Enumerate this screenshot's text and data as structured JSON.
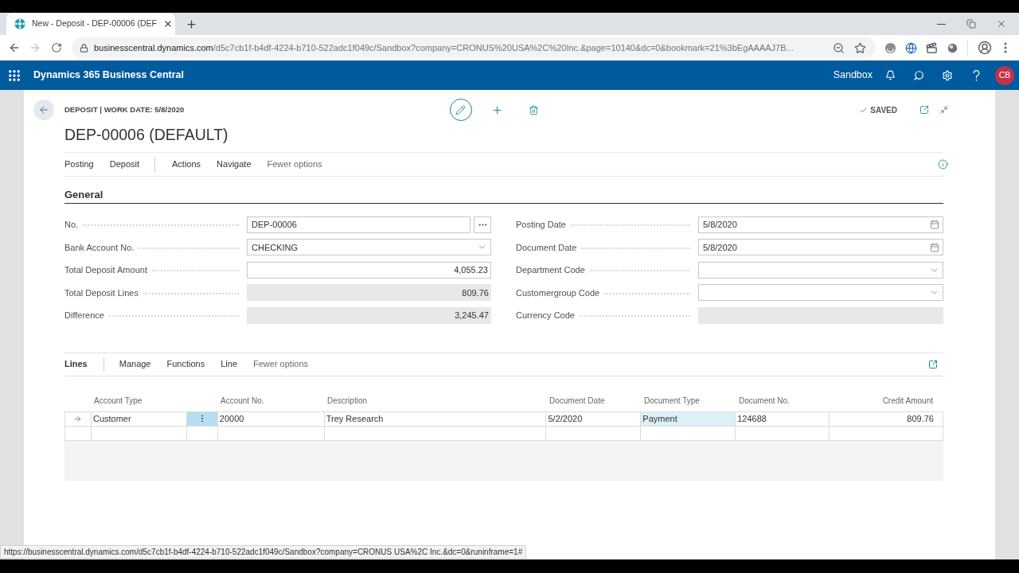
{
  "browser": {
    "tab_title": "New - Deposit - DEP-00006 (DEF",
    "forward_disabled": true,
    "url_host": "businesscentral.dynamics.com",
    "url_path": "/d5c7cb1f-b4df-4224-b710-522adc1f049c/Sandbox?company=CRONUS%20USA%2C%20Inc.&page=10140&dc=0&bookmark=21%3bEgAAAAJ7B...",
    "status_url": "https://businesscentral.dynamics.com/d5c7cb1f-b4df-4224-b710-522adc1f049c/Sandbox?company=CRONUS USA%2C Inc.&dc=0&runinframe=1#"
  },
  "app_bar": {
    "title": "Dynamics 365 Business Central",
    "environment": "Sandbox",
    "avatar": "CB"
  },
  "page": {
    "caption": "DEPOSIT | WORK DATE: 5/8/2020",
    "title": "DEP-00006 (DEFAULT)",
    "save_status": "SAVED",
    "action_groups": [
      {
        "items": [
          "Posting",
          "Deposit"
        ]
      },
      {
        "items": [
          "Actions",
          "Navigate"
        ]
      }
    ],
    "options_toggle": "Fewer options"
  },
  "general": {
    "title": "General",
    "left_fields": [
      {
        "label": "No.",
        "kind": "lookup",
        "value": "DEP-00006"
      },
      {
        "label": "Bank Account No.",
        "kind": "dropdown",
        "value": "CHECKING"
      },
      {
        "label": "Total Deposit Amount",
        "kind": "amount",
        "value": "4,055.23"
      },
      {
        "label": "Total Deposit Lines",
        "kind": "readonly",
        "value": "809.76"
      },
      {
        "label": "Difference",
        "kind": "readonly",
        "value": "3,245.47"
      }
    ],
    "right_fields": [
      {
        "label": "Posting Date",
        "kind": "date",
        "value": "5/8/2020"
      },
      {
        "label": "Document Date",
        "kind": "date",
        "value": "5/8/2020"
      },
      {
        "label": "Department Code",
        "kind": "dropdown"
      },
      {
        "label": "Customergroup Code",
        "kind": "dropdown"
      },
      {
        "label": "Currency Code",
        "kind": "readonly"
      }
    ]
  },
  "lines": {
    "title": "Lines",
    "actions": [
      "Manage",
      "Functions",
      "Line"
    ],
    "options_toggle": "Fewer options",
    "columns": [
      {
        "label": "Account Type",
        "kind": "text"
      },
      {
        "label": "Account No.",
        "kind": "text"
      },
      {
        "label": "Description",
        "kind": "text"
      },
      {
        "label": "Document Date",
        "kind": "text"
      },
      {
        "label": "Document Type",
        "kind": "text"
      },
      {
        "label": "Document No.",
        "kind": "text"
      },
      {
        "label": "Credit Amount",
        "kind": "amount"
      }
    ],
    "rows": [
      {
        "selected": true,
        "cells": [
          {
            "text": "Customer",
            "highlighted": false
          },
          {
            "text": "20000",
            "highlighted": false
          },
          {
            "text": "Trey Research",
            "highlighted": false
          },
          {
            "text": "5/2/2020",
            "highlighted": false
          },
          {
            "text": "Payment",
            "highlighted": true
          },
          {
            "text": "124688",
            "highlighted": false
          },
          {
            "text": "809.76",
            "highlighted": false
          }
        ]
      },
      {
        "selected": false
      }
    ]
  }
}
